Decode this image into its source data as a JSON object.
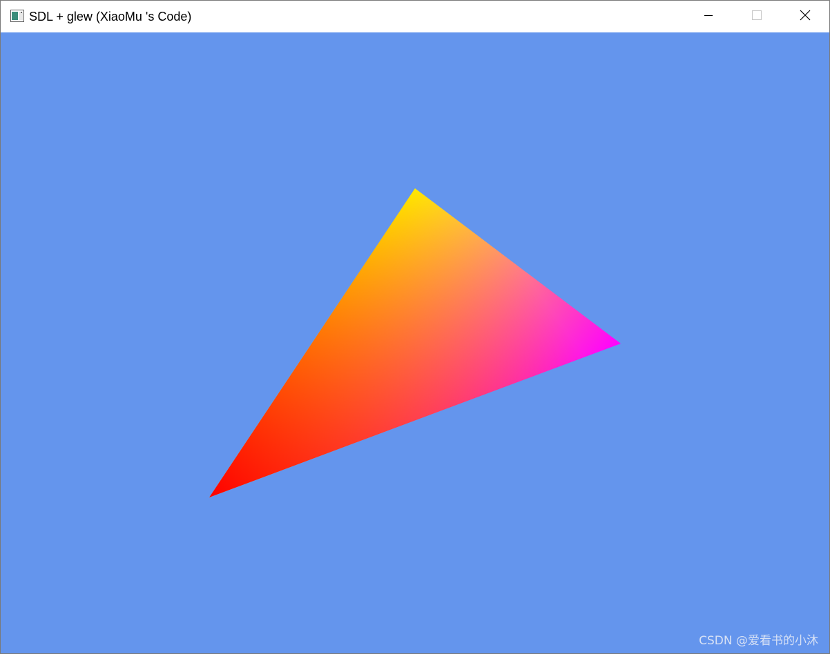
{
  "window": {
    "title": "SDL + glew (XiaoMu 's Code)",
    "icon": "app-window-icon",
    "controls": {
      "minimize_icon": "minimize-icon",
      "maximize_icon": "maximize-icon",
      "close_icon": "close-icon"
    }
  },
  "canvas": {
    "clear_color": "#6495ED",
    "triangle": {
      "vertex_colors": {
        "top": "#FFFF00",
        "right": "#FF00FF",
        "bottom_left": "#FF0000"
      }
    }
  },
  "watermark": {
    "text": "CSDN @爱看书的小沐"
  }
}
